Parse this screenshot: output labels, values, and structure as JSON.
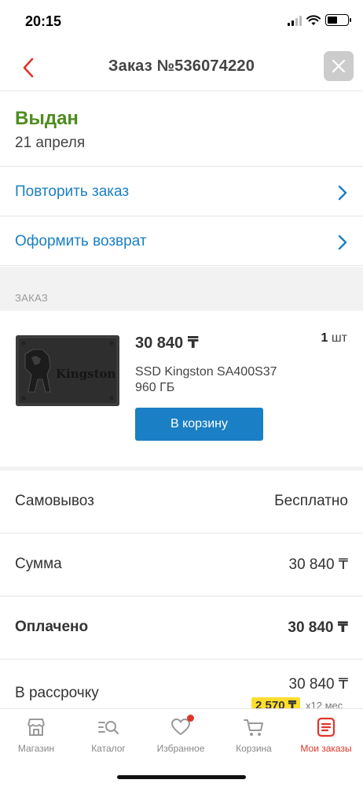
{
  "status_bar": {
    "time": "20:15",
    "battery_level": 0.5
  },
  "header": {
    "title": "Заказ №536074220",
    "back_icon": "chevron-left-icon",
    "close_icon": "close-icon"
  },
  "order": {
    "status": "Выдан",
    "date": "21 апреля",
    "status_color": "#4f8c1f"
  },
  "actions": [
    {
      "label": "Повторить заказ"
    },
    {
      "label": "Оформить возврат"
    }
  ],
  "section": {
    "title": "ЗАКАЗ"
  },
  "product": {
    "price": "30 840 ₸",
    "quantity_value": "1",
    "quantity_unit": "шт",
    "name_line1": "SSD Kingston SA400S37",
    "name_line2": "960 ГБ",
    "image_brand": "Kingston",
    "cart_button": "В корзину"
  },
  "summary": [
    {
      "label": "Самовывоз",
      "value": "Бесплатно"
    },
    {
      "label": "Сумма",
      "value": "30 840 ₸"
    },
    {
      "label": "Оплачено",
      "value": "30 840 ₸"
    }
  ],
  "installment": {
    "label": "В рассрочку",
    "value": "30 840 ₸",
    "monthly": "2 570 ₸",
    "term": "х12 мес"
  },
  "tabs": [
    {
      "label": "Магазин",
      "icon": "store-icon"
    },
    {
      "label": "Каталог",
      "icon": "catalog-search-icon"
    },
    {
      "label": "Избранное",
      "icon": "heart-icon"
    },
    {
      "label": "Корзина",
      "icon": "cart-icon"
    },
    {
      "label": "Мои заказы",
      "icon": "orders-icon",
      "active": true
    }
  ],
  "colors": {
    "accent_blue": "#1a7fc4",
    "accent_red": "#e0352b",
    "badge_yellow": "#ffdd2d"
  }
}
